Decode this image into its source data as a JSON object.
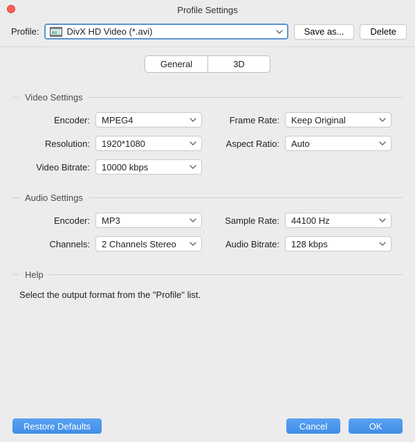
{
  "window": {
    "title": "Profile Settings"
  },
  "toolbar": {
    "profile_label": "Profile:",
    "profile_value": "DivX HD Video (*.avi)",
    "save_as": "Save as...",
    "delete": "Delete"
  },
  "tabs": {
    "general": "General",
    "threeD": "3D",
    "active": "General"
  },
  "video": {
    "group_title": "Video Settings",
    "encoder": {
      "label": "Encoder:",
      "value": "MPEG4"
    },
    "resolution": {
      "label": "Resolution:",
      "value": "1920*1080"
    },
    "bitrate": {
      "label": "Video Bitrate:",
      "value": "10000 kbps"
    },
    "framerate": {
      "label": "Frame Rate:",
      "value": "Keep Original"
    },
    "aspect": {
      "label": "Aspect Ratio:",
      "value": "Auto"
    }
  },
  "audio": {
    "group_title": "Audio Settings",
    "encoder": {
      "label": "Encoder:",
      "value": "MP3"
    },
    "channels": {
      "label": "Channels:",
      "value": "2 Channels Stereo"
    },
    "sample": {
      "label": "Sample Rate:",
      "value": "44100 Hz"
    },
    "bitrate": {
      "label": "Audio Bitrate:",
      "value": "128 kbps"
    }
  },
  "help": {
    "group_title": "Help",
    "text": "Select the output format from the \"Profile\" list."
  },
  "buttons": {
    "restore": "Restore Defaults",
    "cancel": "Cancel",
    "ok": "OK"
  }
}
